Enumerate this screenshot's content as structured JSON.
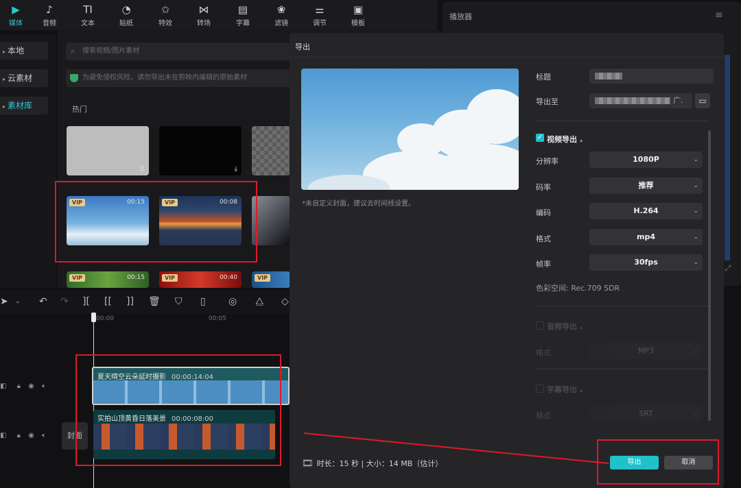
{
  "toolbar": {
    "tabs": [
      {
        "label": "媒体",
        "icon": "media-icon",
        "glyph": "▶"
      },
      {
        "label": "音频",
        "icon": "audio-icon",
        "glyph": "♪"
      },
      {
        "label": "文本",
        "icon": "text-icon",
        "glyph": "TI"
      },
      {
        "label": "贴纸",
        "icon": "sticker-icon",
        "glyph": "◔"
      },
      {
        "label": "特效",
        "icon": "effects-icon",
        "glyph": "✩"
      },
      {
        "label": "转场",
        "icon": "transition-icon",
        "glyph": "⋈"
      },
      {
        "label": "字幕",
        "icon": "caption-icon",
        "glyph": "▤"
      },
      {
        "label": "滤镜",
        "icon": "filter-icon",
        "glyph": "❀"
      },
      {
        "label": "调节",
        "icon": "adjust-icon",
        "glyph": "⚌"
      },
      {
        "label": "模板",
        "icon": "template-icon",
        "glyph": "▣"
      }
    ],
    "active_color": "#2fc6d0"
  },
  "leftnav": {
    "items": [
      {
        "label": "本地"
      },
      {
        "label": "云素材"
      },
      {
        "label": "素材库"
      }
    ]
  },
  "media": {
    "search_placeholder": "搜索视频/图片素材",
    "notice": "为避免侵权风险，请勿导出未在剪映内编辑的原始素材",
    "section": "热门",
    "clips": [
      {
        "vip": "VIP",
        "duration": "00:15"
      },
      {
        "vip": "VIP",
        "duration": "00:08"
      },
      {
        "vip": "VIP",
        "duration": "00:15"
      },
      {
        "vip": "VIP",
        "duration": "00:40"
      },
      {
        "vip": "VIP",
        "duration": ""
      }
    ]
  },
  "player": {
    "title": "播放器"
  },
  "timeline": {
    "ruler": [
      "00:00",
      "00:05"
    ],
    "tracks": [
      {
        "label": "夏天晴空云朵延时摄影",
        "time": "00:00:14:04"
      },
      {
        "label": "实拍山顶黄昏日落美景",
        "time": "00:00:08:00"
      }
    ],
    "cover": "封面"
  },
  "export": {
    "title": "导出",
    "cover_note": "*未自定义封面，建议去时间线设置。",
    "fields": {
      "title_label": "标题",
      "dest_label": "导出至",
      "dest_suffix": "广."
    },
    "video": {
      "heading": "视频导出",
      "rows": [
        {
          "label": "分辨率",
          "value": "1080P"
        },
        {
          "label": "码率",
          "value": "推荐"
        },
        {
          "label": "编码",
          "value": "H.264"
        },
        {
          "label": "格式",
          "value": "mp4"
        },
        {
          "label": "帧率",
          "value": "30fps"
        }
      ],
      "colorspace": "色彩空间:  Rec.709 SDR"
    },
    "audio": {
      "heading": "音频导出",
      "row_label": "格式",
      "value": "MP3"
    },
    "subtitle": {
      "heading": "字幕导出",
      "row_label": "格式",
      "value": "SRT"
    },
    "footer": {
      "info": "时长：15 秒 | 大小：14 MB（估计）",
      "export_label": "导出",
      "cancel_label": "取消"
    }
  },
  "colors": {
    "accent": "#20c1cb",
    "annotation": "#e0192b"
  }
}
